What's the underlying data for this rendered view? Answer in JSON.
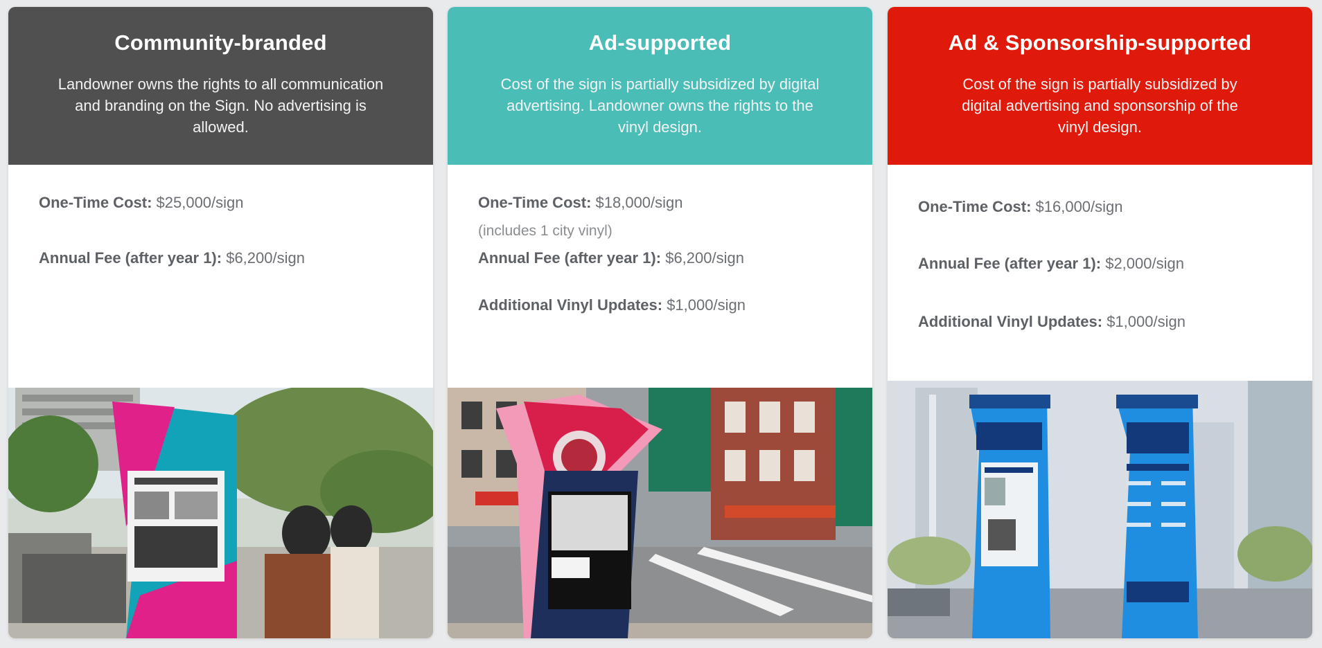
{
  "cards": [
    {
      "title": "Community-branded",
      "description": "Landowner owns the rights to all communication and branding on the Sign. No advertising is allowed.",
      "header_color": "#505050",
      "lines": [
        {
          "label": "One-Time Cost:",
          "value": "$25,000/sign"
        },
        {
          "label": "Annual Fee (after year 1):",
          "value": "$6,200/sign"
        }
      ],
      "photo_icon": "community-sign-photo"
    },
    {
      "title": "Ad-supported",
      "description": "Cost of the sign is partially subsidized by digital advertising. Landowner owns the rights to the vinyl design.",
      "header_color": "#4bbdb7",
      "lines": [
        {
          "label": "One-Time Cost:",
          "value": "$18,000/sign"
        },
        {
          "label": "Annual Fee (after year 1):",
          "value": "$6,200/sign"
        },
        {
          "label": "Additional Vinyl Updates:",
          "value": "$1,000/sign"
        }
      ],
      "note": "(includes 1 city vinyl)",
      "photo_icon": "ad-supported-sign-photo"
    },
    {
      "title": "Ad & Sponsorship-supported",
      "description": "Cost of the sign is partially subsidized by digital advertising and sponsorship of the vinyl design.",
      "header_color": "#e01a0a",
      "lines": [
        {
          "label": "One-Time Cost:",
          "value": "$16,000/sign"
        },
        {
          "label": "Annual Fee (after year 1):",
          "value": "$2,000/sign"
        },
        {
          "label": "Additional Vinyl Updates:",
          "value": "$1,000/sign"
        }
      ],
      "photo_icon": "sponsorship-sign-photo"
    }
  ]
}
